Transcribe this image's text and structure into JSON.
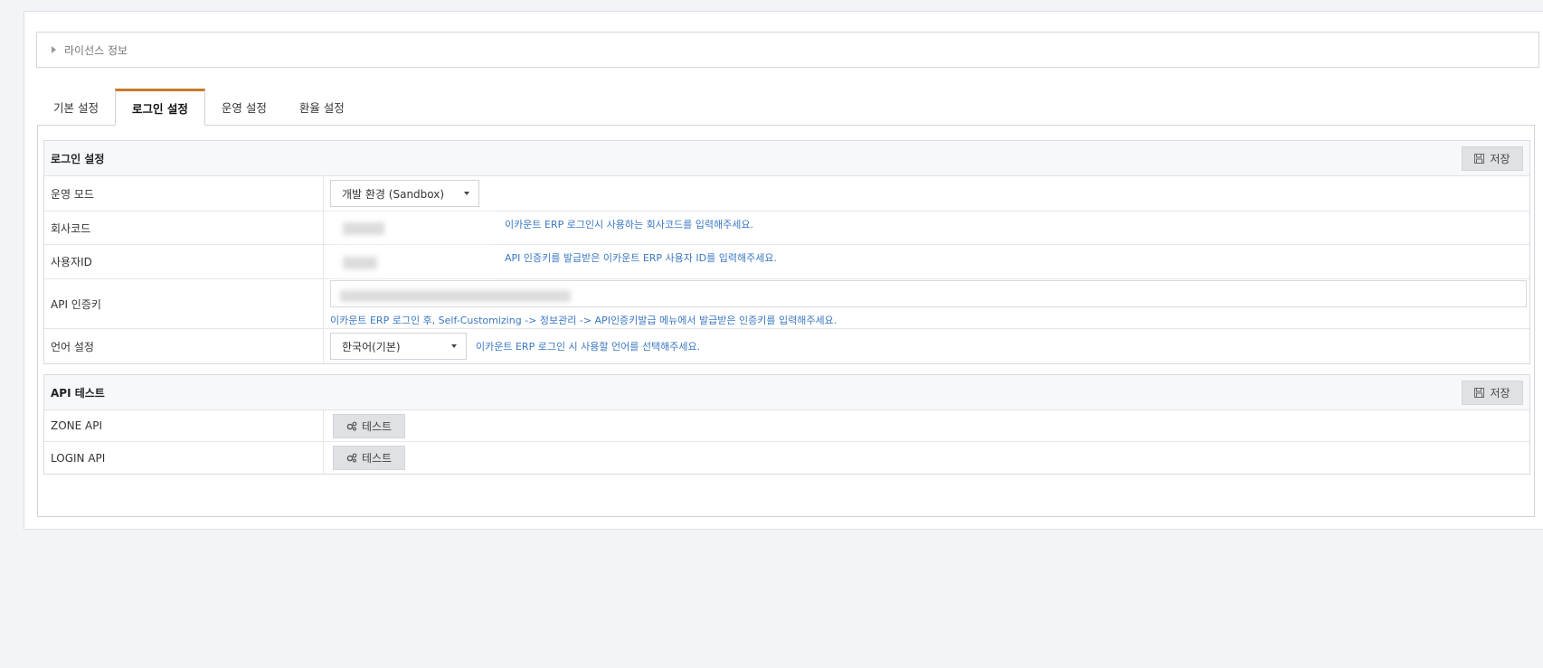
{
  "license": {
    "label": "라이선스 정보"
  },
  "tabs": [
    {
      "label": "기본 설정",
      "active": false
    },
    {
      "label": "로그인 설정",
      "active": true
    },
    {
      "label": "운영 설정",
      "active": false
    },
    {
      "label": "환율 설정",
      "active": false
    }
  ],
  "login_section": {
    "title": "로그인 설정",
    "save_label": "저장",
    "rows": {
      "mode": {
        "label": "운영 모드",
        "value": "개발 환경 (Sandbox)"
      },
      "company_code": {
        "label": "회사코드",
        "hint": "이카운트 ERP 로그인시 사용하는 회사코드를 입력해주세요."
      },
      "user_id": {
        "label": "사용자ID",
        "hint": "API 인증키를 발급받은 이카운트 ERP 사용자 ID를 입력해주세요."
      },
      "api_key": {
        "label": "API 인증키",
        "hint": "이카운트 ERP 로그인 후, Self-Customizing -> 정보관리 -> API인증키발급 메뉴에서 발급받은 인증키를 입력해주세요."
      },
      "language": {
        "label": "언어 설정",
        "value": "한국어(기본)",
        "hint": "이카운트 ERP 로그인 시 사용할 언어를 선택해주세요."
      }
    }
  },
  "api_section": {
    "title": "API 테스트",
    "save_label": "저장",
    "rows": [
      {
        "label": "ZONE API",
        "button": "테스트"
      },
      {
        "label": "LOGIN API",
        "button": "테스트"
      }
    ]
  },
  "colors": {
    "accent_tab": "#c87a2a",
    "hint": "#3b78c3"
  }
}
